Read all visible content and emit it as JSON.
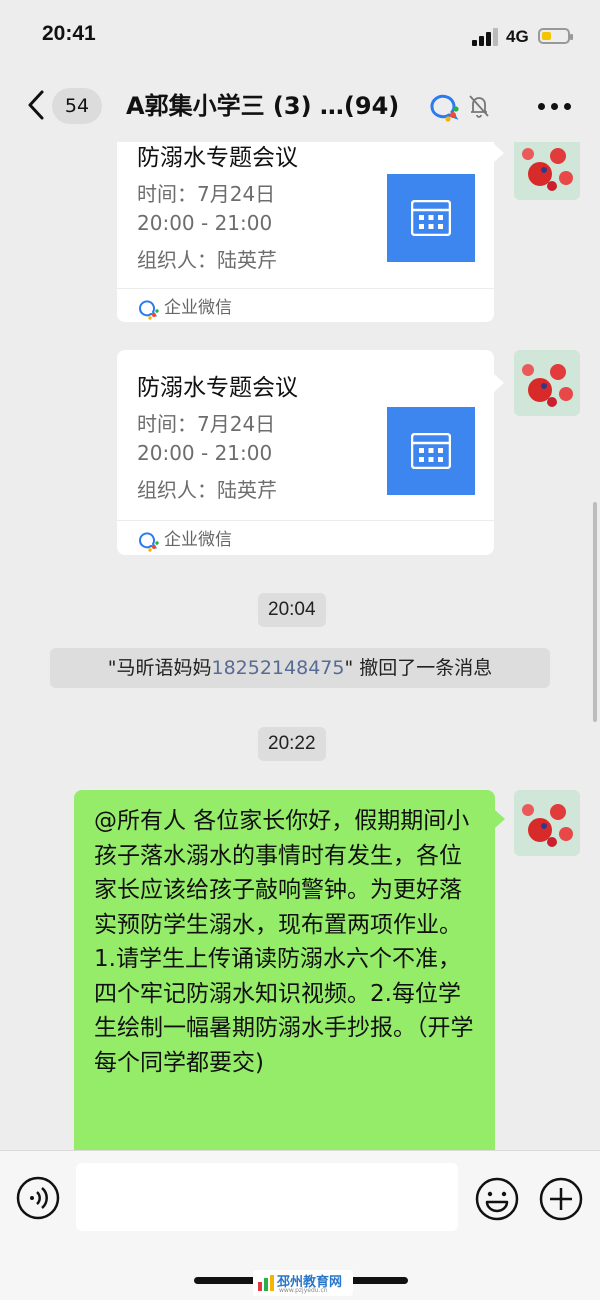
{
  "status_bar": {
    "time": "20:41",
    "network": "4G",
    "battery_level": 0.35,
    "battery_color": "#f5c400"
  },
  "nav": {
    "unread_count": "54",
    "title": "A郭集小学三 (3) …(94)"
  },
  "messages": {
    "card1": {
      "title": "防溺水专题会议",
      "time_line": "时间：7月24日",
      "range_line": "20:00 - 21:00",
      "organizer_line": "组织人：陆英芹",
      "source": "企业微信"
    },
    "card2": {
      "title": "防溺水专题会议",
      "time_line": "时间：7月24日",
      "range_line": "20:00 - 21:00",
      "organizer_line": "组织人：陆英芹",
      "source": "企业微信"
    },
    "timestamp1": "20:04",
    "recall": {
      "prefix": "\"马昕语妈妈",
      "phone": "18252148475",
      "suffix": "\" 撤回了一条消息"
    },
    "timestamp2": "20:22",
    "announcement": "@所有人 各位家长你好，假期期间小孩子落水溺水的事情时有发生，各位家长应该给孩子敲响警钟。为更好落实预防学生溺水，现布置两项作业。1.请学生上传诵读防溺水六个不准，四个牢记防溺水知识视频。2.每位学生绘制一幅暑期防溺水手抄报。（开学每个同学都要交)"
  },
  "input_bar": {
    "value": "",
    "placeholder": ""
  },
  "watermark": {
    "name": "邳州教育网",
    "url": "www.pzjyedu.cn"
  },
  "colors": {
    "background": "#ededed",
    "bubble_green": "#95ec69",
    "calendar_blue": "#3d86f0",
    "link_blue": "#576b95"
  },
  "icons": [
    "back-chevron-icon",
    "wecom-icon",
    "mute-bell-icon",
    "more-dots-icon",
    "calendar-icon",
    "voice-icon",
    "emoji-icon",
    "plus-icon"
  ]
}
